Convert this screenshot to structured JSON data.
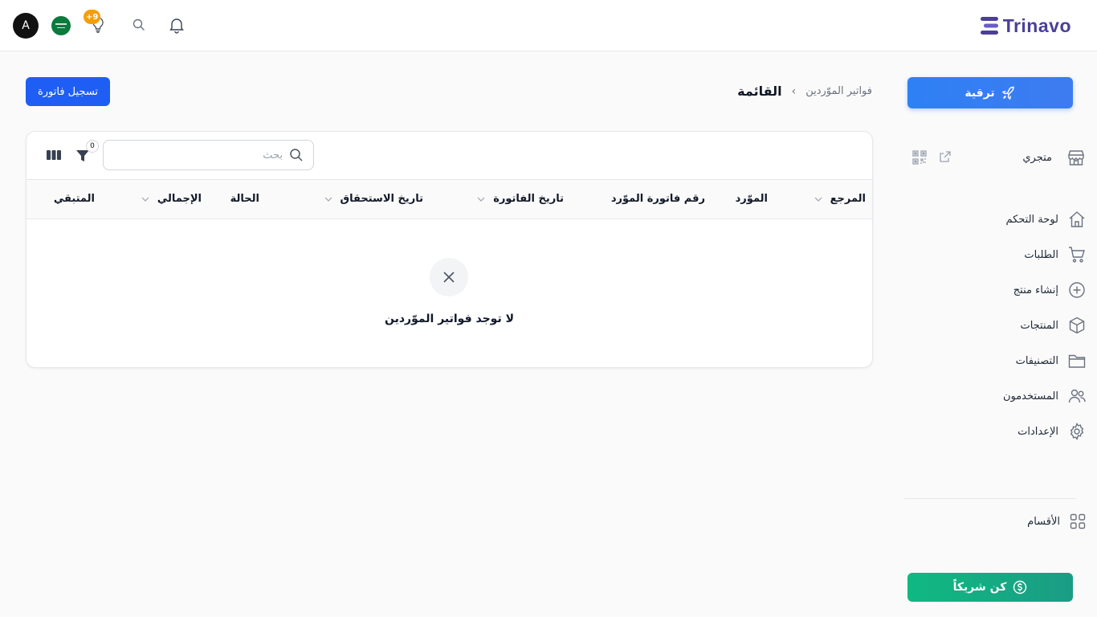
{
  "header": {
    "avatar_initial": "A",
    "notification_count": "+9",
    "brand_name": "Trinavo"
  },
  "sidebar": {
    "upgrade_label": "ترقية",
    "store_label": "متجري",
    "items": [
      {
        "label": "لوحة التحكم",
        "icon": "home-icon"
      },
      {
        "label": "الطلبات",
        "icon": "cart-icon"
      },
      {
        "label": "إنشاء منتج",
        "icon": "plus-circle-icon"
      },
      {
        "label": "المنتجات",
        "icon": "box-icon"
      },
      {
        "label": "التصنيفات",
        "icon": "folder-icon"
      },
      {
        "label": "المستخدمون",
        "icon": "users-icon"
      },
      {
        "label": "الإعدادات",
        "icon": "gear-icon"
      }
    ],
    "sections_label": "الأقسام",
    "partner_label": "كن شريكاً"
  },
  "page": {
    "breadcrumb_parent": "فواتير الموّردين",
    "breadcrumb_sep": "›",
    "breadcrumb_current": "القائمة",
    "register_button": "تسجيل فاتورة"
  },
  "toolbar": {
    "search_placeholder": "بحث",
    "filter_count": "0"
  },
  "table": {
    "columns": [
      "المرجع",
      "الموّرد",
      "رقم فاتورة الموّرد",
      "تاريخ الفاتورة",
      "تاريخ الاستحقاق",
      "الحالة",
      "الإجمالي",
      "المتبقي"
    ],
    "empty_message": "لا توجد فواتير الموّردين"
  },
  "colors": {
    "primary": "#1f5ef5",
    "upgrade": "#2f80f5",
    "partner": "#10b981",
    "brand": "#4b3f99",
    "badge": "#f59e0b"
  }
}
